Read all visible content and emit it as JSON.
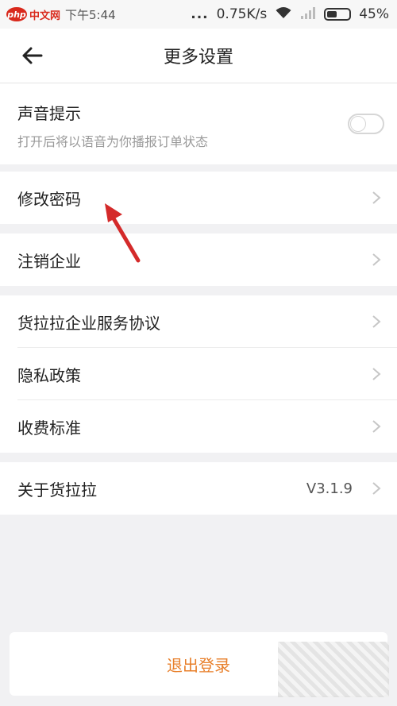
{
  "status_bar": {
    "watermark": {
      "badge": "php",
      "text": "中文网"
    },
    "time": "下午5:44",
    "dots": "...",
    "network_speed": "0.75K/s",
    "battery_text": "45%",
    "battery_level": 0.45
  },
  "header": {
    "title": "更多设置"
  },
  "sound_setting": {
    "title": "声音提示",
    "description": "打开后将以语音为你播报订单状态",
    "enabled": false
  },
  "menu": {
    "change_password": "修改密码",
    "cancel_enterprise": "注销企业",
    "service_agreement": "货拉拉企业服务协议",
    "privacy_policy": "隐私政策",
    "fee_standard": "收费标准",
    "about": "关于货拉拉",
    "version": "V3.1.9"
  },
  "logout": {
    "label": "退出登录"
  },
  "colors": {
    "accent": "#e87f2a",
    "annotation_arrow": "#d42a2a",
    "background": "#f1f1f3"
  }
}
